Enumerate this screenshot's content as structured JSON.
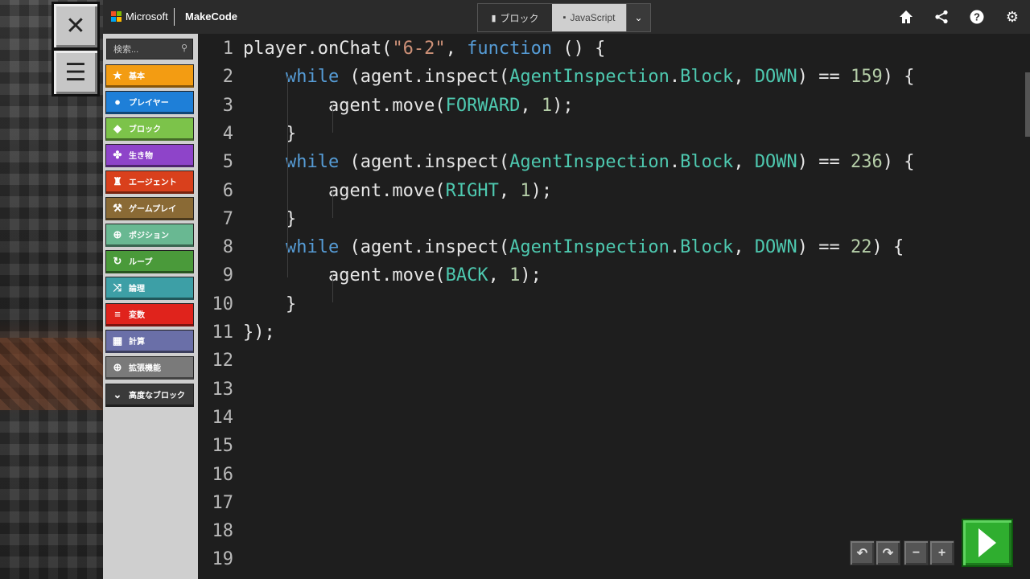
{
  "brand": {
    "microsoft": "Microsoft",
    "product": "MakeCode"
  },
  "mode_toggle": {
    "blocks_label": "ブロック",
    "javascript_label": "JavaScript",
    "active": "javascript"
  },
  "top_icons": [
    "home-icon",
    "share-icon",
    "help-icon",
    "settings-icon"
  ],
  "toolbox": {
    "search_placeholder": "検索...",
    "categories": [
      {
        "label": "基本",
        "icon": "star-icon",
        "color": "#f39c12"
      },
      {
        "label": "プレイヤー",
        "icon": "person-icon",
        "color": "#1e7fd8"
      },
      {
        "label": "ブロック",
        "icon": "cube-icon",
        "color": "#7cc34a"
      },
      {
        "label": "生き物",
        "icon": "paw-icon",
        "color": "#8e44c9"
      },
      {
        "label": "エージェント",
        "icon": "agent-icon",
        "color": "#d9401c"
      },
      {
        "label": "ゲームプレイ",
        "icon": "wrench-icon",
        "color": "#8a6a35"
      },
      {
        "label": "ポジション",
        "icon": "target-icon",
        "color": "#69b892"
      },
      {
        "label": "ループ",
        "icon": "loop-icon",
        "color": "#4a9a3a"
      },
      {
        "label": "論理",
        "icon": "shuffle-icon",
        "color": "#3d9fa6"
      },
      {
        "label": "変数",
        "icon": "list-icon",
        "color": "#e0231c"
      },
      {
        "label": "計算",
        "icon": "calculator-icon",
        "color": "#6a6fa8"
      },
      {
        "label": "拡張機能",
        "icon": "plus-circle-icon",
        "color": "#7a7a7a"
      },
      {
        "label": "高度なブロック",
        "icon": "chevron-down-icon",
        "color": "#3a3a3a"
      }
    ]
  },
  "editor": {
    "line_numbers": [
      "1",
      "2",
      "3",
      "4",
      "5",
      "6",
      "7",
      "8",
      "9",
      "10",
      "11",
      "12",
      "13",
      "14",
      "15",
      "16",
      "17",
      "18",
      "19"
    ],
    "lines": [
      [
        [
          "def",
          "player.onChat("
        ],
        [
          "str",
          "\"6-2\""
        ],
        [
          "def",
          ", "
        ],
        [
          "kw",
          "function"
        ],
        [
          "def",
          " () {"
        ]
      ],
      [
        [
          "def",
          "    "
        ],
        [
          "kw",
          "while"
        ],
        [
          "def",
          " (agent.inspect("
        ],
        [
          "id",
          "AgentInspection"
        ],
        [
          "def",
          "."
        ],
        [
          "id",
          "Block"
        ],
        [
          "def",
          ", "
        ],
        [
          "id",
          "DOWN"
        ],
        [
          "def",
          ") == "
        ],
        [
          "num",
          "159"
        ],
        [
          "def",
          ") {"
        ]
      ],
      [
        [
          "def",
          "        agent.move("
        ],
        [
          "id",
          "FORWARD"
        ],
        [
          "def",
          ", "
        ],
        [
          "num",
          "1"
        ],
        [
          "def",
          ");"
        ]
      ],
      [
        [
          "def",
          "    }"
        ]
      ],
      [
        [
          "def",
          "    "
        ],
        [
          "kw",
          "while"
        ],
        [
          "def",
          " (agent.inspect("
        ],
        [
          "id",
          "AgentInspection"
        ],
        [
          "def",
          "."
        ],
        [
          "id",
          "Block"
        ],
        [
          "def",
          ", "
        ],
        [
          "id",
          "DOWN"
        ],
        [
          "def",
          ") == "
        ],
        [
          "num",
          "236"
        ],
        [
          "def",
          ") {"
        ]
      ],
      [
        [
          "def",
          "        agent.move("
        ],
        [
          "id",
          "RIGHT"
        ],
        [
          "def",
          ", "
        ],
        [
          "num",
          "1"
        ],
        [
          "def",
          ");"
        ]
      ],
      [
        [
          "def",
          "    }"
        ]
      ],
      [
        [
          "def",
          "    "
        ],
        [
          "kw",
          "while"
        ],
        [
          "def",
          " (agent.inspect("
        ],
        [
          "id",
          "AgentInspection"
        ],
        [
          "def",
          "."
        ],
        [
          "id",
          "Block"
        ],
        [
          "def",
          ", "
        ],
        [
          "id",
          "DOWN"
        ],
        [
          "def",
          ") == "
        ],
        [
          "num",
          "22"
        ],
        [
          "def",
          ") {"
        ]
      ],
      [
        [
          "def",
          "        agent.move("
        ],
        [
          "id",
          "BACK"
        ],
        [
          "def",
          ", "
        ],
        [
          "num",
          "1"
        ],
        [
          "def",
          ");"
        ]
      ],
      [
        [
          "def",
          "    }"
        ]
      ],
      [
        [
          "def",
          "});"
        ]
      ],
      [],
      [],
      [],
      [],
      [],
      [],
      [],
      []
    ]
  },
  "controls": [
    "undo-icon",
    "redo-icon",
    "zoom-out-icon",
    "zoom-in-icon",
    "run-icon"
  ]
}
